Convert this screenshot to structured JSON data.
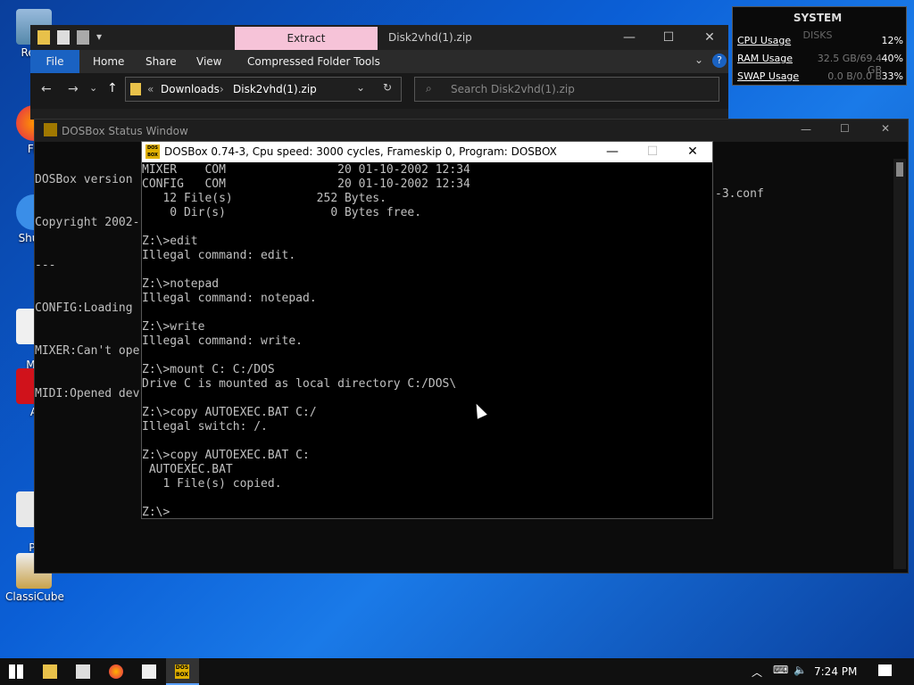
{
  "desktop": {
    "icons": [
      {
        "label": "Recy"
      },
      {
        "label": "Fir"
      },
      {
        "label": "Shuto"
      },
      {
        "label": "Micr\nEd"
      },
      {
        "label": "A"
      },
      {
        "label": "Pro\nHac"
      },
      {
        "label": "ClassiCube"
      }
    ]
  },
  "explorer": {
    "extract_tab": "Extract",
    "title": "Disk2vhd(1).zip",
    "tabs": [
      "File",
      "Home",
      "Share",
      "View",
      "Compressed Folder Tools"
    ],
    "breadcrumb": [
      "Downloads",
      "Disk2vhd(1).zip"
    ],
    "search_placeholder": "Search Disk2vhd(1).zip"
  },
  "status_window": {
    "title": "DOSBox Status Window",
    "lines": [
      "DOSBox version",
      "Copyright 2002-",
      "---",
      "CONFIG:Loading",
      "MIXER:Can't ope",
      "MIDI:Opened dev"
    ],
    "right_text": "-3.conf"
  },
  "dosbox": {
    "title": "DOSBox 0.74-3, Cpu speed:    3000 cycles, Frameskip  0, Program:   DOSBOX",
    "console": [
      "MIXER    COM                20 01-10-2002 12:34",
      "CONFIG   COM                20 01-10-2002 12:34",
      "   12 File(s)            252 Bytes.",
      "    0 Dir(s)               0 Bytes free.",
      "",
      "Z:\\>edit",
      "Illegal command: edit.",
      "",
      "Z:\\>notepad",
      "Illegal command: notepad.",
      "",
      "Z:\\>write",
      "Illegal command: write.",
      "",
      "Z:\\>mount C: C:/DOS",
      "Drive C is mounted as local directory C:/DOS\\",
      "",
      "Z:\\>copy AUTOEXEC.BAT C:/",
      "Illegal switch: /.",
      "",
      "Z:\\>copy AUTOEXEC.BAT C:",
      " AUTOEXEC.BAT",
      "   1 File(s) copied.",
      "",
      "Z:\\>"
    ]
  },
  "system_widget": {
    "title": "SYSTEM",
    "subtitle": "DISKS",
    "rows": [
      {
        "label": "CPU Usage",
        "value": "",
        "percent": "12%"
      },
      {
        "label": "RAM Usage",
        "value": "32.5 GB/69.4 GB",
        "percent": "40%"
      },
      {
        "label": "SWAP Usage",
        "value": "0.0 B/0.0 B",
        "percent": "33%"
      }
    ]
  },
  "taskbar": {
    "clock": "7:24 PM",
    "dosbox_label": "DOS BOX"
  },
  "colors": {
    "accent": "#1a62c2",
    "extract_tab": "#f6c3d8",
    "console_text": "#c0c0c0"
  }
}
